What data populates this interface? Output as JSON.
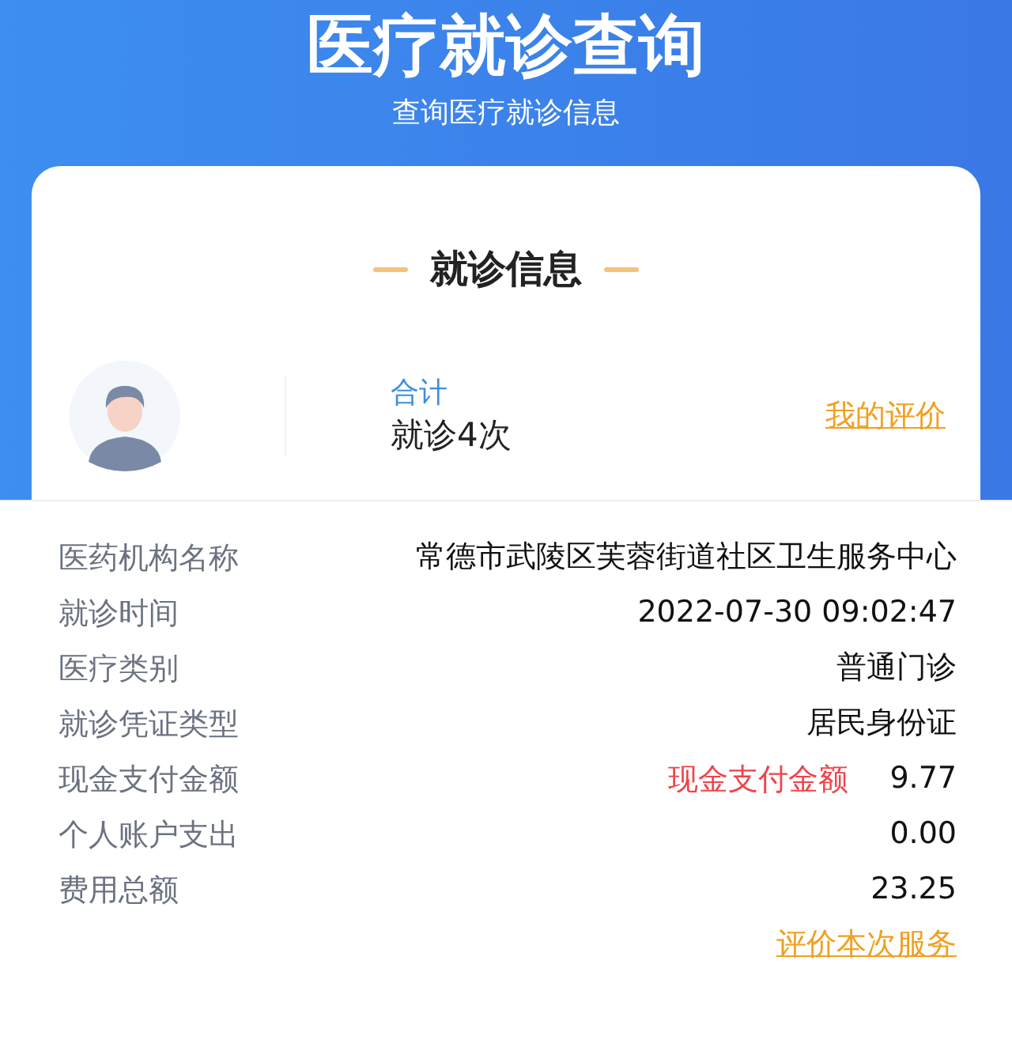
{
  "header": {
    "title": "医疗就诊查询",
    "subtitle": "查询医疗就诊信息"
  },
  "card": {
    "heading": "就诊信息",
    "summary_label": "合计",
    "summary_value": "就诊4次",
    "review_link": "我的评价"
  },
  "details": [
    {
      "label": "医药机构名称",
      "value": "常德市武陵区芙蓉街道社区卫生服务中心"
    },
    {
      "label": "就诊时间",
      "value": "2022-07-30 09:02:47"
    },
    {
      "label": "医疗类别",
      "value": "普通门诊"
    },
    {
      "label": "就诊凭证类型",
      "value": "居民身份证"
    },
    {
      "label": "现金支付金额",
      "note": "现金支付金额",
      "value": "9.77"
    },
    {
      "label": "个人账户支出",
      "value": "0.00"
    },
    {
      "label": "费用总额",
      "value": "23.25"
    }
  ],
  "footer_link": "评价本次服务"
}
